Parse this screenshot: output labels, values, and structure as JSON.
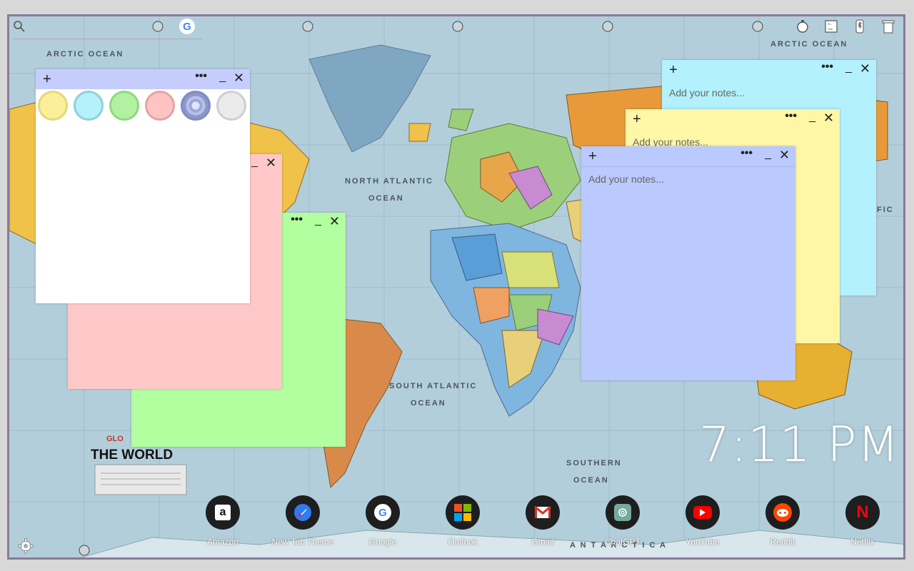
{
  "map": {
    "oceans": {
      "arctic_left": "ARCTIC OCEAN",
      "arctic_right": "ARCTIC OCEAN",
      "north_atlantic_1": "NORTH ATLANTIC",
      "north_atlantic_2": "OCEAN",
      "south_atlantic_1": "SOUTH ATLANTIC",
      "south_atlantic_2": "OCEAN",
      "southern_1": "SOUTHERN",
      "southern_2": "OCEAN",
      "pacific_partial": "CIFIC",
      "antarctica": "A N T A R C T I C A"
    },
    "title": "THE WORLD",
    "brand_partial": "GLO"
  },
  "top_bar": {
    "icons": [
      "search-icon",
      "google-icon",
      "timer-icon",
      "calculator-icon",
      "bluetooth-icon",
      "trash-icon"
    ]
  },
  "notes": [
    {
      "id": "white",
      "color": "#ffffff",
      "header": "#c4cdfb",
      "placeholder": ""
    },
    {
      "id": "pink",
      "color": "#ffc8c8",
      "header": "#ffc8c8",
      "placeholder": ""
    },
    {
      "id": "green",
      "color": "#b1ff9f",
      "header": "#b1ff9f",
      "placeholder": ""
    },
    {
      "id": "cyan",
      "color": "#b2f1fd",
      "header": "#b2f1fd",
      "placeholder": "Add your notes..."
    },
    {
      "id": "yellow",
      "color": "#fff6a6",
      "header": "#fff6a6",
      "placeholder": "Add your notes..."
    },
    {
      "id": "blue",
      "color": "#bac9fe",
      "header": "#bac9fe",
      "placeholder": "Add your notes..."
    }
  ],
  "note_controls": {
    "add": "+",
    "menu": "•••",
    "minimize": "_",
    "close": "✕"
  },
  "swatches": [
    {
      "name": "yellow",
      "fill": "#fcef9c",
      "ring": "#e5d878"
    },
    {
      "name": "cyan",
      "fill": "#b5f1fb",
      "ring": "#8fd0dc"
    },
    {
      "name": "green",
      "fill": "#b1f1a1",
      "ring": "#8fd883"
    },
    {
      "name": "pink",
      "fill": "#ffc3c3",
      "ring": "#e6a3a3"
    },
    {
      "name": "blue-selected",
      "fill": "#9aa7d8",
      "ring": "#7f8cc0"
    },
    {
      "name": "gray",
      "fill": "#ebebeb",
      "ring": "#cfcfcf"
    }
  ],
  "clock": {
    "time": "7:11 PM"
  },
  "dock": [
    {
      "label": "Amazon",
      "icon": "amazon-icon"
    },
    {
      "label": "New Tab Theme",
      "icon": "new-tab-theme-icon"
    },
    {
      "label": "Google",
      "icon": "google-icon"
    },
    {
      "label": "Outlook",
      "icon": "microsoft-icon"
    },
    {
      "label": "Gmail",
      "icon": "gmail-icon"
    },
    {
      "label": "ChatGPT",
      "icon": "chatgpt-icon"
    },
    {
      "label": "YouTube",
      "icon": "youtube-icon"
    },
    {
      "label": "Reddit",
      "icon": "reddit-icon"
    },
    {
      "label": "Netflix",
      "icon": "netflix-icon"
    }
  ],
  "settings": {
    "icon": "gear-icon"
  }
}
